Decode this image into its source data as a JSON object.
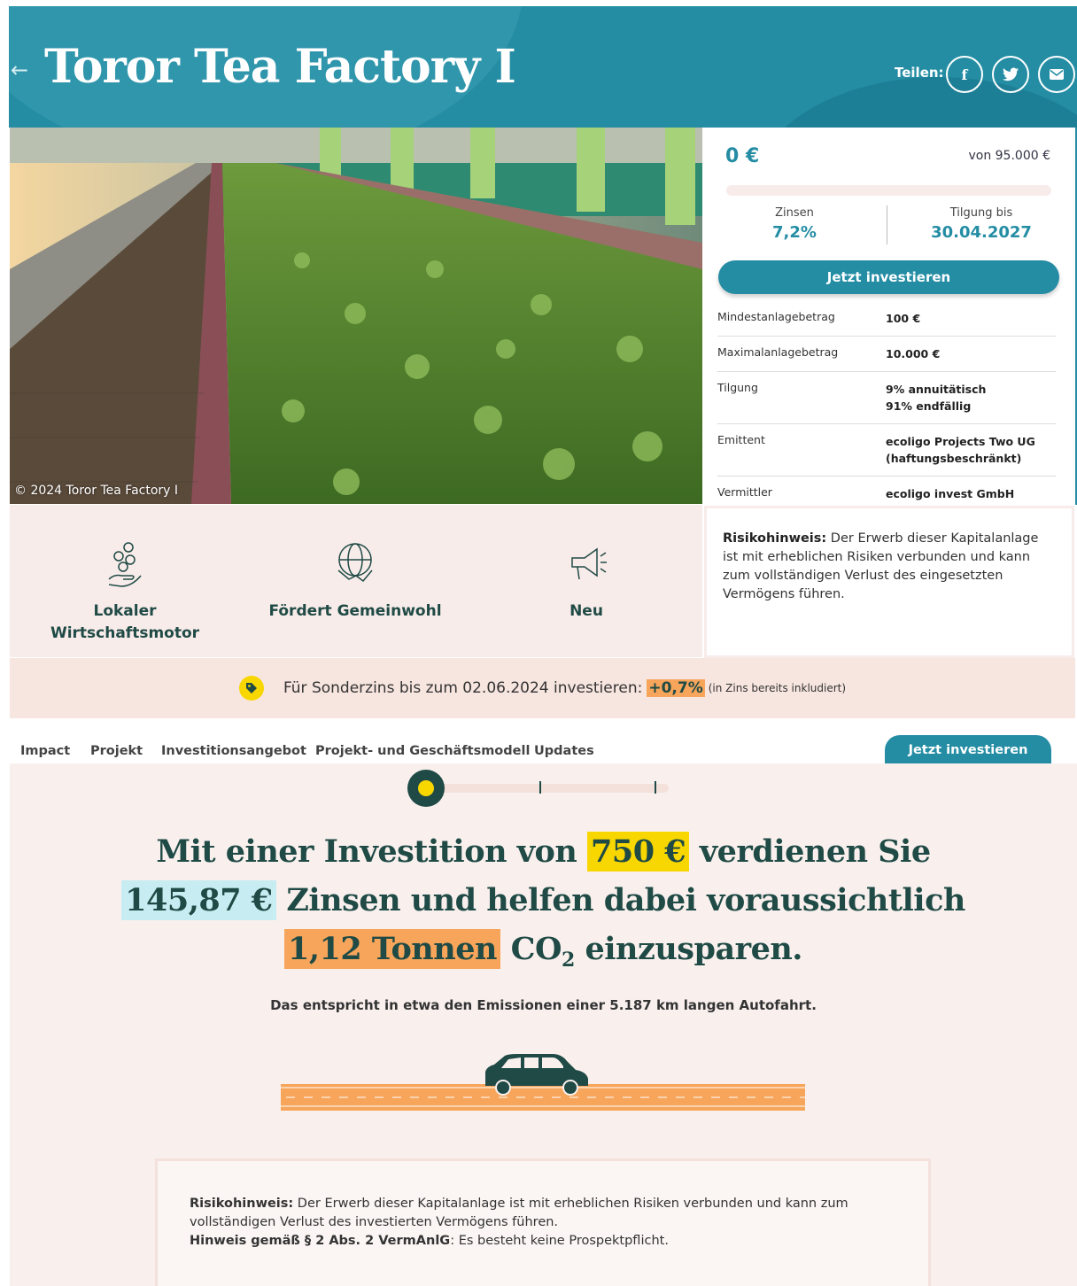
{
  "header": {
    "back_arrow": "←",
    "title": "Toror Tea Factory I",
    "share_label": "Teilen:",
    "share_icons": [
      "facebook-icon",
      "twitter-icon",
      "mail-icon"
    ]
  },
  "hero": {
    "caption": "© 2024 Toror Tea Factory I"
  },
  "funding": {
    "amount": "0 €",
    "goal": "von 95.000 €",
    "progress_percent": 0,
    "interest_label": "Zinsen",
    "interest_value": "7,2%",
    "repayment_label": "Tilgung bis",
    "repayment_value": "30.04.2027",
    "invest_label": "Jetzt investieren"
  },
  "terms": [
    {
      "label": "Mindestanlagebetrag",
      "value": "100 €"
    },
    {
      "label": "Maximalanlagebetrag",
      "value": "10.000 €"
    },
    {
      "label": "Tilgung",
      "value": "9% annuitätisch\n91% endfällig"
    },
    {
      "label": "Emittent",
      "value": "ecoligo Projects Two UG (haftungsbeschränkt)"
    },
    {
      "label": "Vermittler",
      "value": "ecoligo invest GmbH"
    }
  ],
  "features": [
    {
      "label": "Lokaler Wirtschaftsmotor",
      "icon": "coins-hand-icon"
    },
    {
      "label": "Fördert Gemeinwohl",
      "icon": "globe-handshake-icon"
    },
    {
      "label": "Neu",
      "icon": "megaphone-icon"
    }
  ],
  "risk": {
    "bold": "Risikohinweis:",
    "text": " Der Erwerb dieser Kapitalanlage ist mit erheblichen Risiken verbunden und kann zum vollständigen Verlust des eingesetzten Vermögens führen."
  },
  "promo": {
    "text": "Für Sonderzins bis zum 02.06.2024 investieren:",
    "bonus": "+0,7%",
    "note": "(in Zins bereits inkludiert)"
  },
  "nav": {
    "items": [
      "Impact",
      "Projekt",
      "Investitionsangebot",
      "Projekt- und Geschäftsmodell",
      "Updates"
    ],
    "invest_label": "Jetzt investieren"
  },
  "impact": {
    "part1": "Mit einer Investition von",
    "investment": "750 €",
    "part2": "verdienen Sie",
    "interest": "145,87 €",
    "part3": "Zinsen und helfen dabei voraussichtlich",
    "co2": "1,12 Tonnen",
    "co2_word": "CO",
    "co2_sub": "2",
    "part4": "einzusparen.",
    "equivalent": "Das entspricht in etwa den Emissionen einer 5.187 km langen Autofahrt."
  },
  "risk_bottom": {
    "bold": "Risikohinweis:",
    "text": " Der Erwerb dieser Kapitalanlage ist mit erheblichen Risiken verbunden und kann zum vollständigen Verlust des investierten Vermögens führen.",
    "hint_bold": "Hinweis gemäß § 2 Abs. 2 VermAnlG",
    "hint_text": ": Es besteht keine Prospektpflicht."
  },
  "colors": {
    "brand": "#248da4",
    "dark": "#1f4a45",
    "yellow": "#f8d700",
    "orange": "#f6a55b",
    "cyan": "#c7ecf2",
    "blush": "#f8ecea"
  }
}
